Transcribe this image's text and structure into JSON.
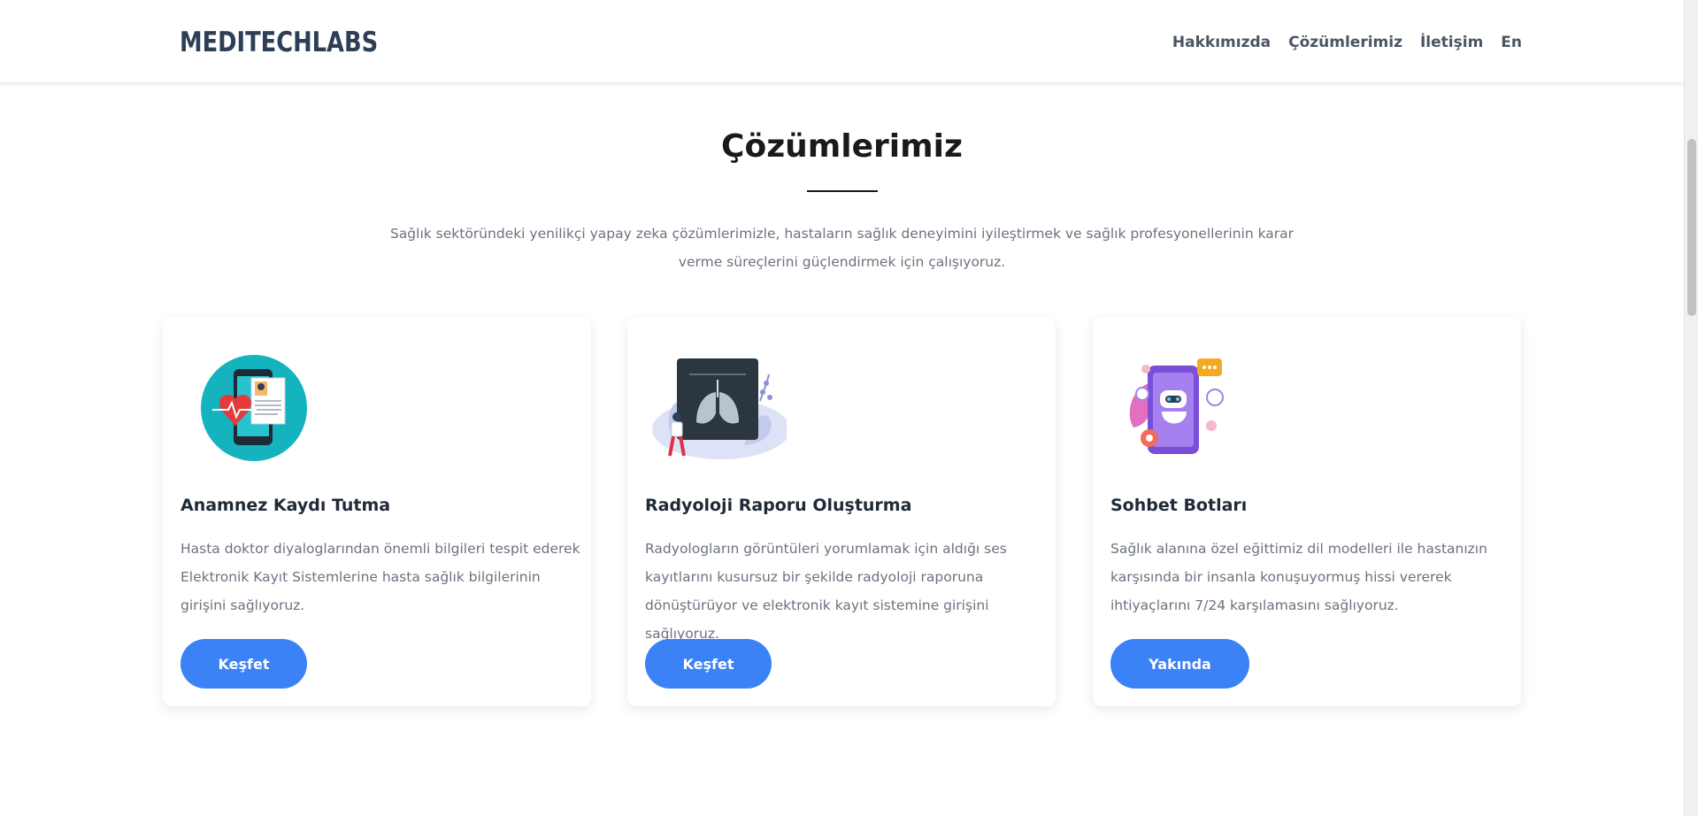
{
  "brand": {
    "logo_text": "MEDITECHLABS",
    "color": "#2e3e55"
  },
  "nav": {
    "items": [
      {
        "label": "Hakkımızda"
      },
      {
        "label": "Çözümlerimiz"
      },
      {
        "label": "İletişim"
      },
      {
        "label": "En"
      }
    ]
  },
  "section": {
    "title": "Çözümlerimiz",
    "intro": "Sağlık sektöründeki yenilikçi yapay zeka çözümlerimizle, hastaların sağlık deneyimini iyileştirmek ve sağlık profesyonellerinin karar verme süreçlerini güçlendirmek için çalışıyoruz."
  },
  "cards": [
    {
      "icon": "medical-record-phone-icon",
      "title": "Anamnez Kaydı Tutma",
      "text": "Hasta doktor diyaloglarından önemli bilgileri tespit ederek Elektronik Kayıt Sistemlerine hasta sağlık bilgilerinin girişini sağlıyoruz.",
      "button": "Keşfet"
    },
    {
      "icon": "lung-xray-icon",
      "title": "Radyoloji Raporu Oluşturma",
      "text": "Radyologların görüntüleri yorumlamak için aldığı ses kayıtlarını kusursuz bir şekilde radyoloji raporuna dönüştürüyor ve elektronik kayıt sistemine girişini sağlıyoruz.",
      "button": "Keşfet"
    },
    {
      "icon": "chatbot-robot-icon",
      "title": "Sohbet Botları",
      "text": "Sağlık alanına özel eğittimiz dil modelleri ile hastanızın karşısında bir insanla konuşuyormuş hissi vererek ihtiyaçlarını 7/24 karşılamasını sağlıyoruz.",
      "button": "Yakında"
    }
  ],
  "colors": {
    "accent": "#3b82f6",
    "heading": "#1a1a1a",
    "body_text": "#6b7280"
  }
}
